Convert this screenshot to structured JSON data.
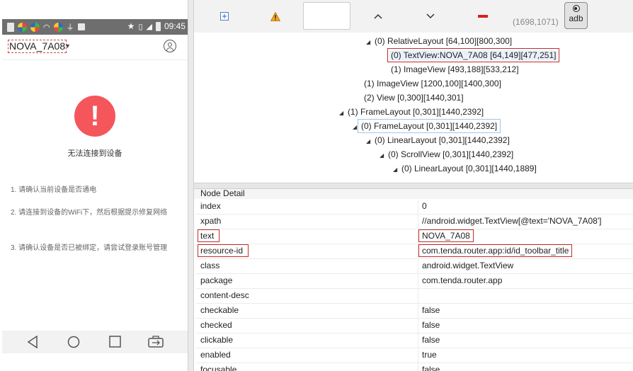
{
  "phone": {
    "status_time": "09:45",
    "toolbar_title": "NOVA_7A08",
    "error_message": "无法连接到设备",
    "hints": [
      "1. 请确认当前设备是否通电",
      "2. 请连接到设备的WiFi下，然后根据提示修复网络",
      "3. 请确认设备是否已被绑定，请尝试登录账号管理"
    ],
    "error_icon_glyph": "!",
    "error_color": "#f5565b"
  },
  "toolbar": {
    "coords": "(1698,1071)",
    "adb_label": "adb"
  },
  "tree": [
    {
      "indent": 1,
      "expander": "◢",
      "label": "(0) RelativeLayout [64,100][800,300]"
    },
    {
      "indent": 2,
      "expander": "",
      "label": "(0) TextView:NOVA_7A08 [64,149][477,251]",
      "state": "selected"
    },
    {
      "indent": 2,
      "expander": "",
      "label": "(1) ImageView [493,188][533,212]"
    },
    {
      "indent": 0,
      "expander": "",
      "label": "(1) ImageView [1200,100][1400,300]"
    },
    {
      "indent": 0,
      "expander": "",
      "label": "(2) View [0,300][1440,301]"
    },
    {
      "indent": -1,
      "expander": "◢",
      "label": "(1) FrameLayout [0,301][1440,2392]"
    },
    {
      "indent": 0,
      "expander": "◢",
      "label": "(0) FrameLayout [0,301][1440,2392]",
      "state": "hover"
    },
    {
      "indent": 1,
      "expander": "◢",
      "label": "(0) LinearLayout [0,301][1440,2392]"
    },
    {
      "indent": 2,
      "expander": "◢",
      "label": "(0) ScrollView [0,301][1440,2392]"
    },
    {
      "indent": 3,
      "expander": "◢",
      "label": "(0) LinearLayout [0,301][1440,1889]"
    }
  ],
  "detail": {
    "title": "Node Detail",
    "rows": [
      {
        "key": "index",
        "value": "0"
      },
      {
        "key": "xpath",
        "value": "//android.widget.TextView[@text='NOVA_7A08']"
      },
      {
        "key": "text",
        "value": "NOVA_7A08",
        "highlight": true
      },
      {
        "key": "resource-id",
        "value": "com.tenda.router.app:id/id_toolbar_title",
        "highlight": true
      },
      {
        "key": "class",
        "value": "android.widget.TextView"
      },
      {
        "key": "package",
        "value": "com.tenda.router.app"
      },
      {
        "key": "content-desc",
        "value": ""
      },
      {
        "key": "checkable",
        "value": "false"
      },
      {
        "key": "checked",
        "value": "false"
      },
      {
        "key": "clickable",
        "value": "false"
      },
      {
        "key": "enabled",
        "value": "true"
      },
      {
        "key": "focusable",
        "value": "false"
      }
    ]
  },
  "colors": {
    "highlight_border": "#c42c2c",
    "selection_bg": "#e9f2fc",
    "warning": "#f08c00",
    "delete": "#d81e1e",
    "expand_icon": "#4a7fc1"
  }
}
